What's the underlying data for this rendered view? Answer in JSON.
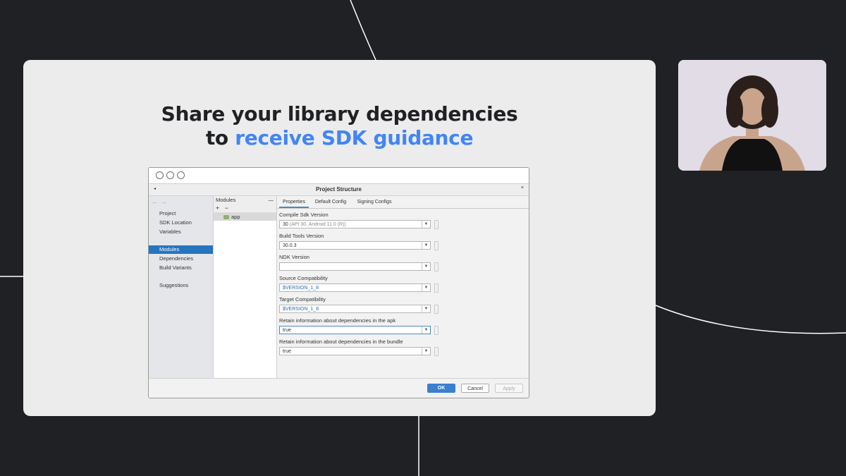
{
  "headline": {
    "line1": "Share your library dependencies",
    "line2_prefix": "to ",
    "line2_accent": "receive SDK guidance"
  },
  "dialog": {
    "title": "Project Structure",
    "nav": {
      "items": [
        "Project",
        "SDK Location",
        "Variables",
        "Modules",
        "Dependencies",
        "Build Variants",
        "Suggestions"
      ],
      "selected": "Modules"
    },
    "modules": {
      "header": "Modules",
      "add": "+",
      "remove": "−",
      "minimize": "—",
      "items": [
        "app"
      ]
    },
    "tabs": [
      "Properties",
      "Default Config",
      "Signing Configs"
    ],
    "active_tab": "Properties",
    "fields": [
      {
        "label": "Compile Sdk Version",
        "value": "30",
        "hint": "(API 30, Android 11.0 (R))"
      },
      {
        "label": "Build Tools Version",
        "value": "30.0.3"
      },
      {
        "label": "NDK Version",
        "value": ""
      },
      {
        "label": "Source Compatibility",
        "value": "$VERSION_1_8"
      },
      {
        "label": "Target Compatibility",
        "value": "$VERSION_1_8"
      },
      {
        "label": "Retain information about dependencies in the apk",
        "value": "true"
      },
      {
        "label": "Retain information about dependencies in the bundle",
        "value": "true"
      }
    ],
    "buttons": {
      "ok": "OK",
      "cancel": "Cancel",
      "apply": "Apply"
    }
  },
  "colors": {
    "background": "#202124",
    "slide": "#ececec",
    "accent": "#4285f4",
    "selection": "#2675bf",
    "ok_button": "#3b7fcf"
  }
}
